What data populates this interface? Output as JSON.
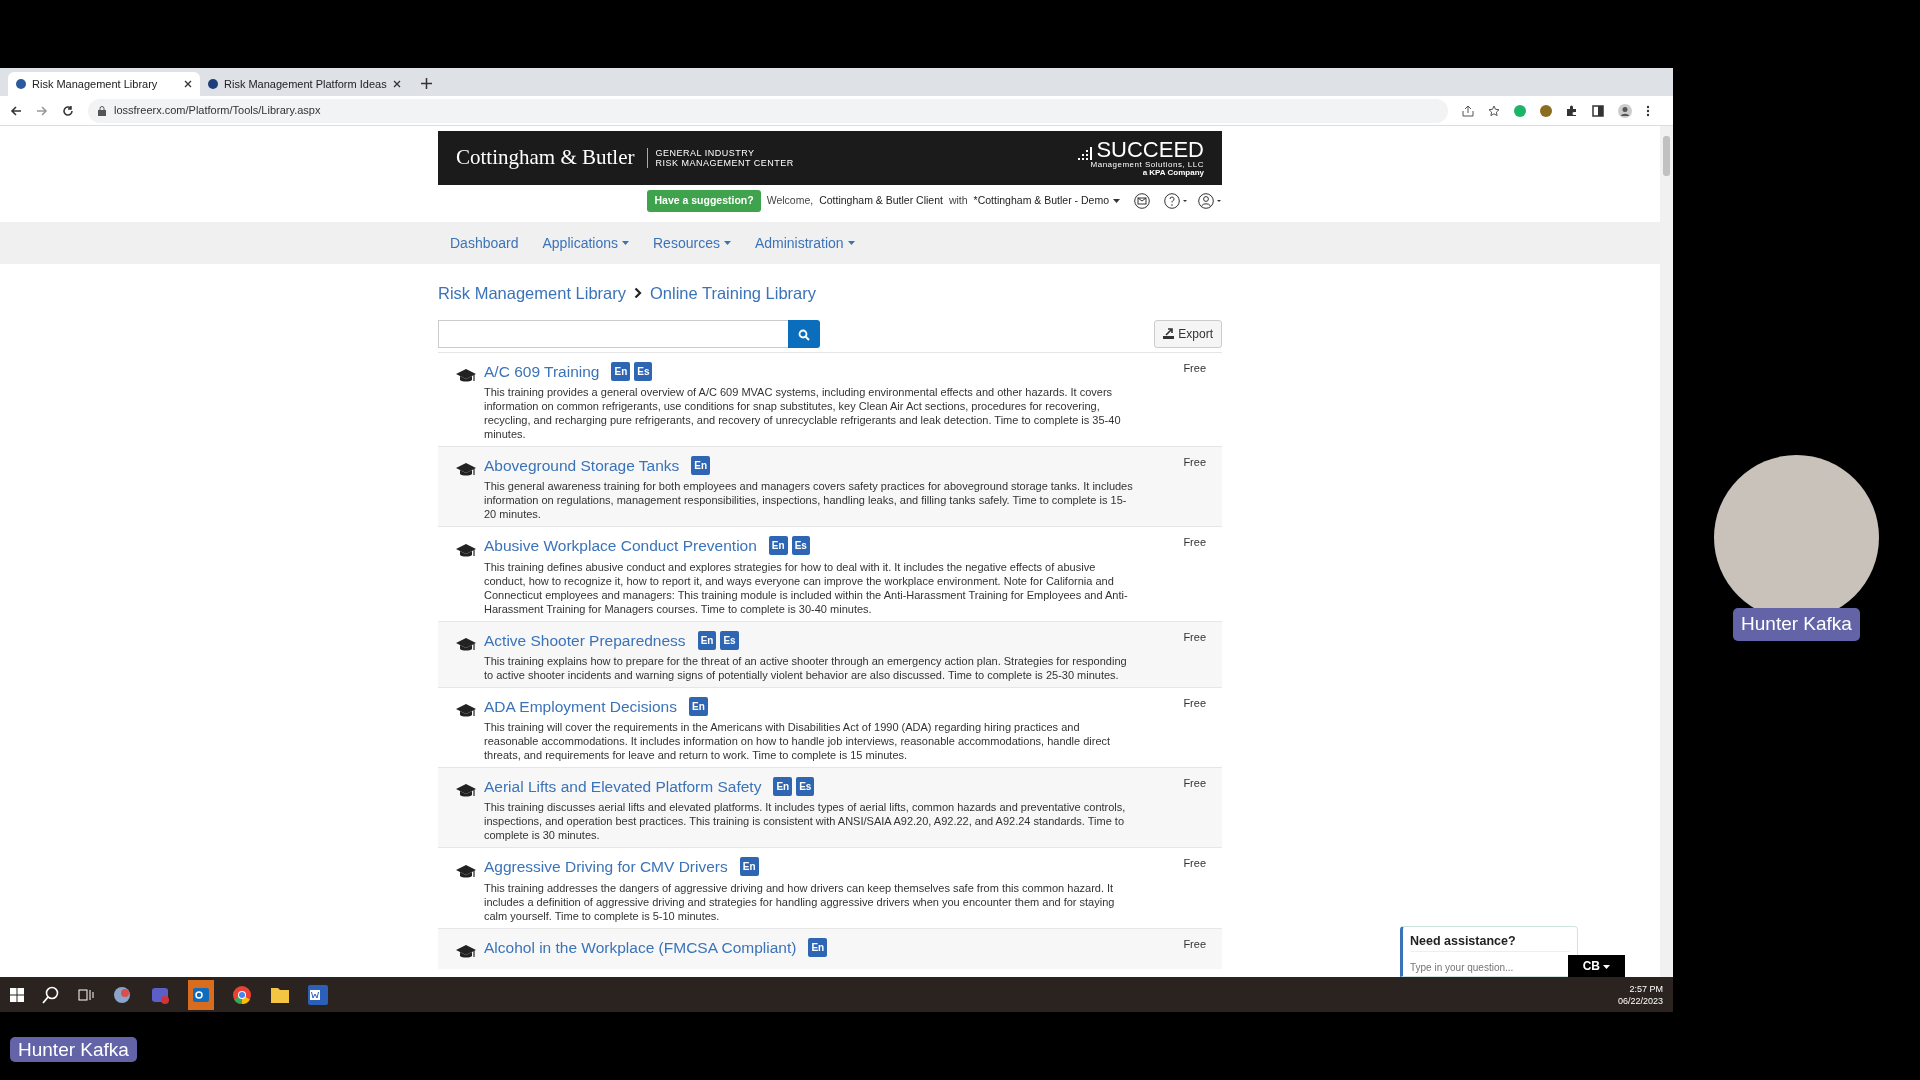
{
  "browser": {
    "tabs": [
      {
        "title": "Risk Management Library",
        "selected": true
      },
      {
        "title": "Risk Management Platform Ideas",
        "selected": false
      }
    ],
    "url": "lossfreerx.com/Platform/Tools/Library.aspx"
  },
  "header": {
    "brand": "Cottingham & Butler",
    "subtitle_1": "GENERAL INDUSTRY",
    "subtitle_2": "RISK MANAGEMENT CENTER",
    "partner": "SUCCEED",
    "partner_line_1": "Management Solutions, LLC",
    "partner_line_2": "a KPA Company"
  },
  "user_bar": {
    "suggestion_button": "Have a suggestion?",
    "welcome": "Welcome,",
    "user": "Cottingham & Butler Client",
    "with": "with",
    "account": "*Cottingham & Butler - Demo"
  },
  "nav": [
    {
      "label": "Dashboard",
      "dropdown": false
    },
    {
      "label": "Applications",
      "dropdown": true
    },
    {
      "label": "Resources",
      "dropdown": true
    },
    {
      "label": "Administration",
      "dropdown": true
    }
  ],
  "breadcrumb": [
    "Risk Management Library",
    "Online Training Library"
  ],
  "export_button": "Export",
  "courses": [
    {
      "title": "A/C 609 Training",
      "languages": [
        "En",
        "Es"
      ],
      "price": "Free",
      "description": "This training provides a general overview of A/C 609 MVAC systems, including environmental effects and other hazards. It covers information on common refrigerants, use conditions for snap substitutes, key Clean Air Act sections, procedures for recovering, recycling, and recharging pure refrigerants, and recovery of unrecyclable refrigerants and leak detection. Time to complete is 35-40 minutes."
    },
    {
      "title": "Aboveground Storage Tanks",
      "languages": [
        "En"
      ],
      "price": "Free",
      "description": "This general awareness training for both employees and managers covers safety practices for aboveground storage tanks. It includes information on regulations, management responsibilities, inspections, handling leaks, and filling tanks safely. Time to complete is 15-20 minutes."
    },
    {
      "title": "Abusive Workplace Conduct Prevention",
      "languages": [
        "En",
        "Es"
      ],
      "price": "Free",
      "description": "This training defines abusive conduct and explores strategies for how to deal with it. It includes the negative effects of abusive conduct, how to recognize it, how to report it, and ways everyone can improve the workplace environment. Note for California and Connecticut employees and managers: This training module is included within the Anti-Harassment Training for Employees and Anti-Harassment Training for Managers courses. Time to complete is 30-40 minutes."
    },
    {
      "title": "Active Shooter Preparedness",
      "languages": [
        "En",
        "Es"
      ],
      "price": "Free",
      "description": "This training explains how to prepare for the threat of an active shooter through an emergency action plan. Strategies for responding to active shooter incidents and warning signs of potentially violent behavior are also discussed. Time to complete is 25-30 minutes."
    },
    {
      "title": "ADA Employment Decisions",
      "languages": [
        "En"
      ],
      "price": "Free",
      "description": "This training will cover the requirements in the Americans with Disabilities Act of 1990 (ADA) regarding hiring practices and reasonable accommodations. It includes information on how to handle job interviews, reasonable accommodations, handle direct threats, and requirements for leave and return to work. Time to complete is 15 minutes."
    },
    {
      "title": "Aerial Lifts and Elevated Platform Safety",
      "languages": [
        "En",
        "Es"
      ],
      "price": "Free",
      "description": "This training discusses aerial lifts and elevated platforms. It includes types of aerial lifts, common hazards and preventative controls, inspections, and operation best practices. This training is consistent with ANSI/SAIA A92.20, A92.22, and A92.24 standards. Time to complete is 30 minutes."
    },
    {
      "title": "Aggressive Driving for CMV Drivers",
      "languages": [
        "En"
      ],
      "price": "Free",
      "description": "This training addresses the dangers of aggressive driving and how drivers can keep themselves safe from this common hazard. It includes a definition of aggressive driving and strategies for handling aggressive drivers when you encounter them and for staying calm yourself. Time to complete is 5-10 minutes."
    },
    {
      "title": "Alcohol in the Workplace (FMCSA Compliant)",
      "languages": [
        "En"
      ],
      "price": "Free"
    }
  ],
  "chat": {
    "title": "Need assistance?",
    "placeholder": "Type in your question...",
    "widget_button": "CB"
  },
  "taskbar": {
    "time": "2:57 PM",
    "date": "06/22/2023"
  },
  "video": {
    "participant": "Hunter Kafka",
    "caption": "Hunter Kafka"
  }
}
